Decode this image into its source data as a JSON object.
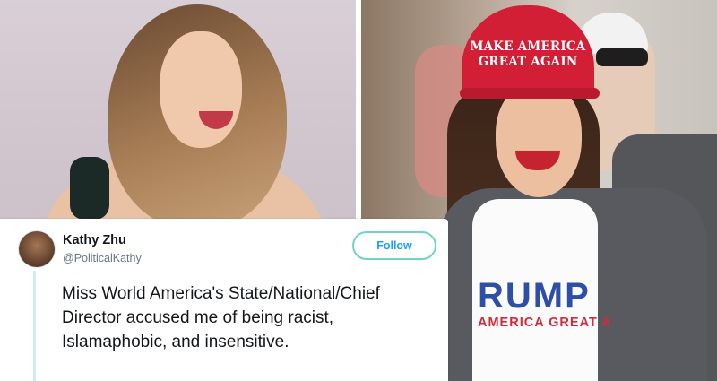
{
  "cap": {
    "line1": "MAKE AMERICA",
    "line2": "GREAT AGAIN"
  },
  "shirt": {
    "big_text": "RUMP",
    "small_text": "AMERICA GREAT A"
  },
  "tweet": {
    "author_name": "Kathy Zhu",
    "author_handle": "@PoliticalKathy",
    "follow_label": "Follow",
    "body": "Miss World America's State/National/Chief Director accused me of being racist, Islamaphobic, and insensitive."
  },
  "colors": {
    "follow_border": "#6fd4c5",
    "follow_text": "#1da1f2",
    "cap_red": "#d21f36",
    "shirt_blue": "#2e4fa7",
    "shirt_red": "#d32b3b"
  }
}
